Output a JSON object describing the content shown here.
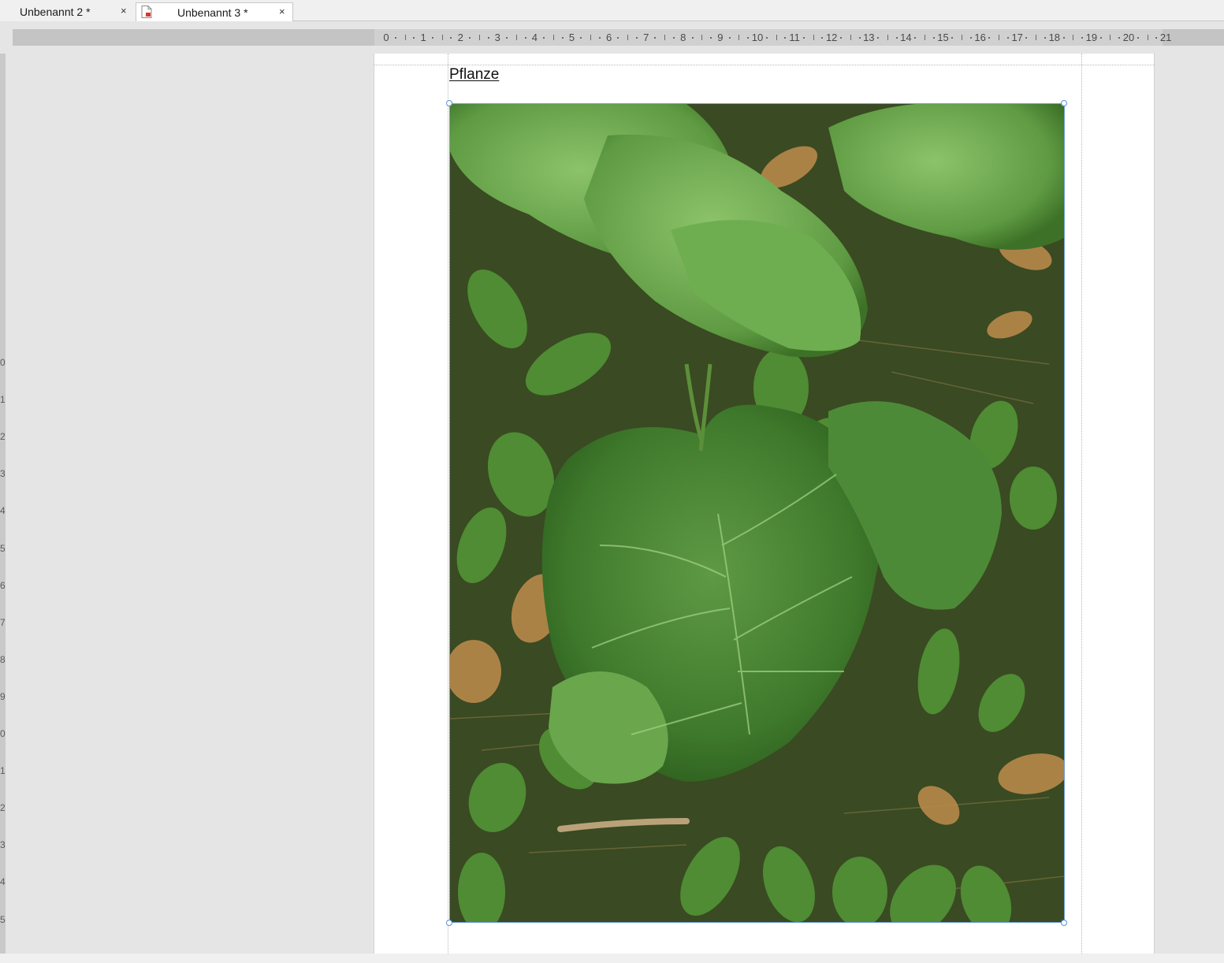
{
  "tabs": [
    {
      "label": "Unbenannt 2 *",
      "active": false,
      "close": "×"
    },
    {
      "label": "Unbenannt 3 *",
      "active": true,
      "close": "×",
      "icon": "pdf-document-icon"
    }
  ],
  "ruler": {
    "labels": [
      "0",
      "1",
      "2",
      "3",
      "4",
      "5",
      "6",
      "7",
      "8",
      "9",
      "10",
      "11",
      "12",
      "13",
      "14",
      "15",
      "16",
      "17",
      "18",
      "19",
      "20",
      "21"
    ]
  },
  "vruler": {
    "labels": [
      "0",
      "1",
      "2",
      "3",
      "4",
      "5",
      "6",
      "7",
      "8",
      "9",
      "0",
      "1",
      "2",
      "3",
      "4",
      "5"
    ]
  },
  "document": {
    "title": "Pflanze",
    "image": {
      "subject": "green plant leaves",
      "selected": true
    }
  },
  "colors": {
    "selection": "#6f9fd6",
    "workspace": "#e5e5e5",
    "ruler": "#c4c4c4",
    "page": "#ffffff"
  }
}
